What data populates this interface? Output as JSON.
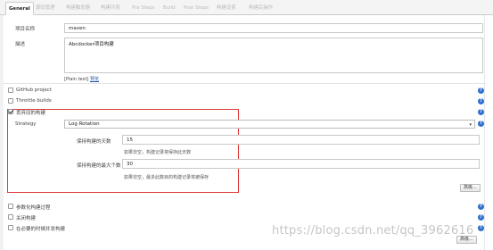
{
  "tabs": [
    "General",
    "源码管理",
    "构建触发器",
    "构建环境",
    "Pre Steps",
    "Build",
    "Post Steps",
    "构建设置",
    "构建后操作"
  ],
  "form": {
    "project_name_label": "项目名称",
    "project_name_value": "maven",
    "description_label": "描述",
    "description_value": "Abcdocker项目构建",
    "plain_text_prefix": "[Plain text]",
    "plain_text_link": "预览"
  },
  "options": {
    "github_project": "GitHub project",
    "throttle_builds": "Throttle builds",
    "discard_old_builds": "丢弃旧的构建"
  },
  "discard": {
    "strategy_label": "Strategy",
    "strategy_value": "Log Rotation",
    "days_label": "保持构建的天数",
    "days_value": "15",
    "days_hint": "如果非空，构建记录将保存此天数",
    "max_label": "保持构建的最大个数",
    "max_value": "30",
    "max_hint": "如果非空，最多此数目的构建记录将被保存",
    "advanced_button": "高级..."
  },
  "bottom_options": {
    "parameterized": "参数化构建过程",
    "disable_build": "关闭构建",
    "concurrent": "在必要的时候并发构建",
    "advanced_button": "高级..."
  },
  "watermark": "https://blog.csdn.net/qq_3962616",
  "colors": {
    "highlight_box": "#e03a3a",
    "help_icon": "#2f6fd1",
    "link": "#2255aa"
  }
}
